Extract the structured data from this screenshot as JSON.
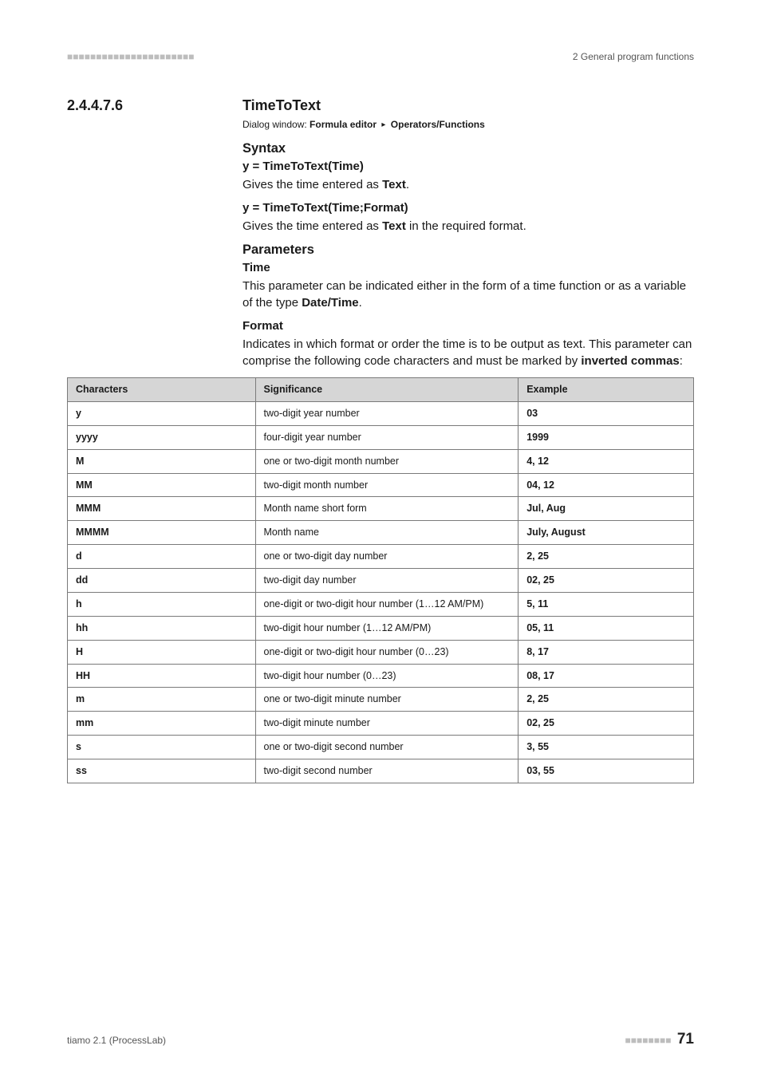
{
  "header": {
    "dashes": "■■■■■■■■■■■■■■■■■■■■■■",
    "right": "2 General program functions"
  },
  "section": {
    "number": "2.4.4.7.6",
    "title": "TimeToText"
  },
  "dialog": {
    "prefix": "Dialog window: ",
    "part1": "Formula editor",
    "sep": "▸",
    "part2": "Operators/Functions"
  },
  "syntax": {
    "heading": "Syntax",
    "sig1": "y = TimeToText(Time)",
    "desc1_pre": "Gives the time entered as ",
    "desc1_bold": "Text",
    "desc1_post": ".",
    "sig2": "y = TimeToText(Time;Format)",
    "desc2_pre": "Gives the time entered as ",
    "desc2_bold": "Text",
    "desc2_post": " in the required format."
  },
  "params": {
    "heading": "Parameters",
    "time_name": "Time",
    "time_desc_pre": "This parameter can be indicated either in the form of a time function or as a variable of the type ",
    "time_desc_bold": "Date/Time",
    "time_desc_post": ".",
    "format_name": "Format",
    "format_desc_pre": "Indicates in which format or order the time is to be output as text. This parameter can comprise the following code characters and must be marked by ",
    "format_desc_bold": "inverted commas",
    "format_desc_post": ":"
  },
  "table": {
    "head": {
      "c": "Characters",
      "s": "Significance",
      "e": "Example"
    },
    "rows": [
      {
        "c": "y",
        "s": "two-digit year number",
        "e": "03"
      },
      {
        "c": "yyyy",
        "s": "four-digit year number",
        "e": "1999"
      },
      {
        "c": "M",
        "s": "one or two-digit month number",
        "e": "4, 12"
      },
      {
        "c": "MM",
        "s": "two-digit month number",
        "e": "04, 12"
      },
      {
        "c": "MMM",
        "s": "Month name short form",
        "e": "Jul, Aug"
      },
      {
        "c": "MMMM",
        "s": "Month name",
        "e": "July, August"
      },
      {
        "c": "d",
        "s": "one or two-digit day number",
        "e": "2, 25"
      },
      {
        "c": "dd",
        "s": "two-digit day number",
        "e": "02, 25"
      },
      {
        "c": "h",
        "s": "one-digit or two-digit hour number (1…12 AM/PM)",
        "e": "5, 11"
      },
      {
        "c": "hh",
        "s": "two-digit hour number (1…12 AM/PM)",
        "e": "05, 11"
      },
      {
        "c": "H",
        "s": "one-digit or two-digit hour number (0…23)",
        "e": "8, 17"
      },
      {
        "c": "HH",
        "s": "two-digit hour number (0…23)",
        "e": "08, 17"
      },
      {
        "c": "m",
        "s": "one or two-digit minute number",
        "e": "2, 25"
      },
      {
        "c": "mm",
        "s": "two-digit minute number",
        "e": "02, 25"
      },
      {
        "c": "s",
        "s": "one or two-digit second number",
        "e": "3, 55"
      },
      {
        "c": "ss",
        "s": "two-digit second number",
        "e": "03, 55"
      }
    ]
  },
  "footer": {
    "left": "tiamo 2.1 (ProcessLab)",
    "dashes": "■■■■■■■■",
    "page": "71"
  }
}
